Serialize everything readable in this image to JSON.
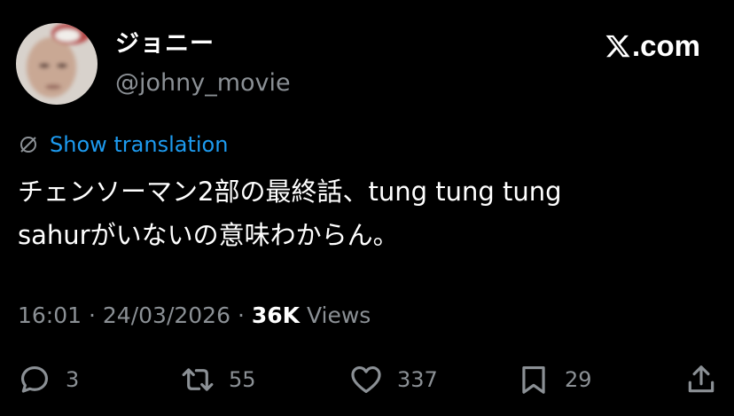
{
  "author": {
    "display_name": "ジョニー",
    "handle": "@johny_movie"
  },
  "brand": {
    "logo_icon": "x-logo-icon",
    "suffix": ".com"
  },
  "translate": {
    "icon": "translate-globe-icon",
    "label": "Show translation"
  },
  "tweet": {
    "text_line_1": "チェンソーマン2部の最終話、tung tung tung",
    "text_line_2": "sahurがいないの意味わからん。"
  },
  "meta": {
    "time": "16:01",
    "separator": "·",
    "date": "24/03/2026",
    "views_count": "36K",
    "views_label": "Views"
  },
  "actions": {
    "reply_count": "3",
    "retweet_count": "55",
    "like_count": "337",
    "bookmark_count": "29"
  },
  "colors": {
    "background": "#000000",
    "primary_text": "#ffffff",
    "secondary_text": "#8b9095",
    "link": "#1d9bf0"
  }
}
